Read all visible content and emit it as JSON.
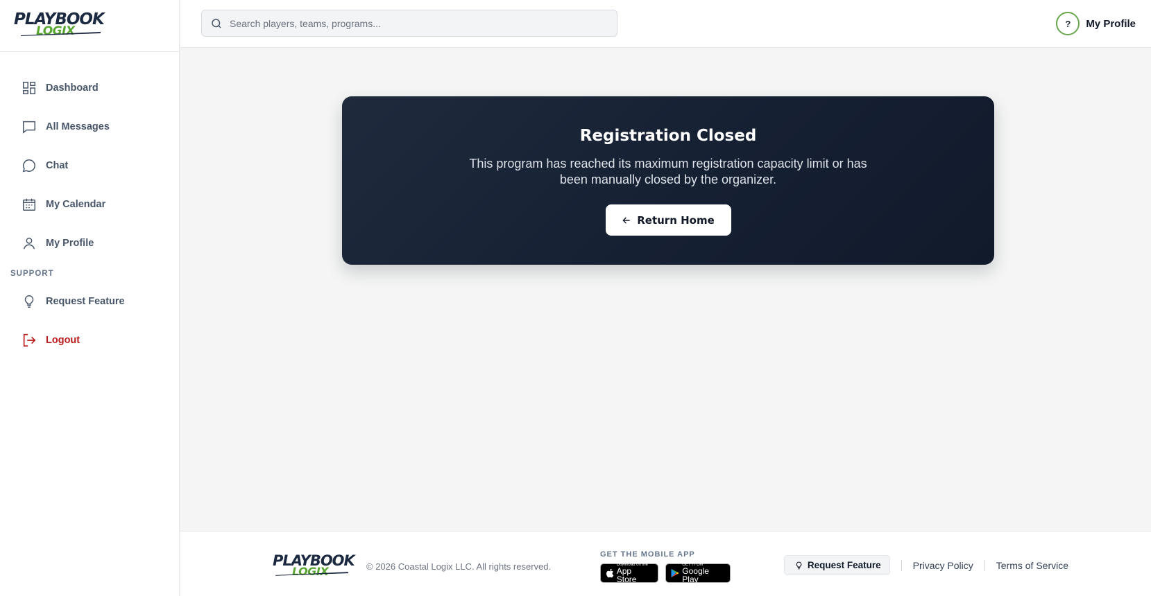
{
  "brand": {
    "logo_top": "PLAYBOOK",
    "logo_bottom": "LOGIX"
  },
  "colors": {
    "navy": "#1b2a40",
    "green": "#5aa632",
    "logout_red": "#b91c1c",
    "card_bg": "#162033"
  },
  "sidebar": {
    "items": [
      {
        "label": "Dashboard",
        "icon": "dashboard-grid-icon"
      },
      {
        "label": "All Messages",
        "icon": "message-square-icon"
      },
      {
        "label": "Chat",
        "icon": "chat-bubble-icon"
      },
      {
        "label": "My Calendar",
        "icon": "calendar-icon"
      },
      {
        "label": "My Profile",
        "icon": "user-icon"
      }
    ],
    "support_label": "SUPPORT",
    "support_items": [
      {
        "label": "Request Feature",
        "icon": "lightbulb-icon"
      },
      {
        "label": "Logout",
        "icon": "logout-icon"
      }
    ]
  },
  "topbar": {
    "search_placeholder": "Search players, teams, programs...",
    "profile_initial": "?",
    "profile_label": "My Profile"
  },
  "card": {
    "title": "Registration Closed",
    "message": "This program has reached its maximum registration capacity limit or has been manually closed by the organizer.",
    "button_label": "Return Home"
  },
  "footer": {
    "copyright": "© 2026 Coastal Logix LLC. All rights reserved.",
    "mobile_app_label": "GET THE MOBILE APP",
    "app_store_small": "Download on the",
    "app_store_big": "App Store",
    "google_play_small": "GET IT ON",
    "google_play_big": "Google Play",
    "request_feature": "Request Feature",
    "privacy": "Privacy Policy",
    "terms": "Terms of Service"
  }
}
